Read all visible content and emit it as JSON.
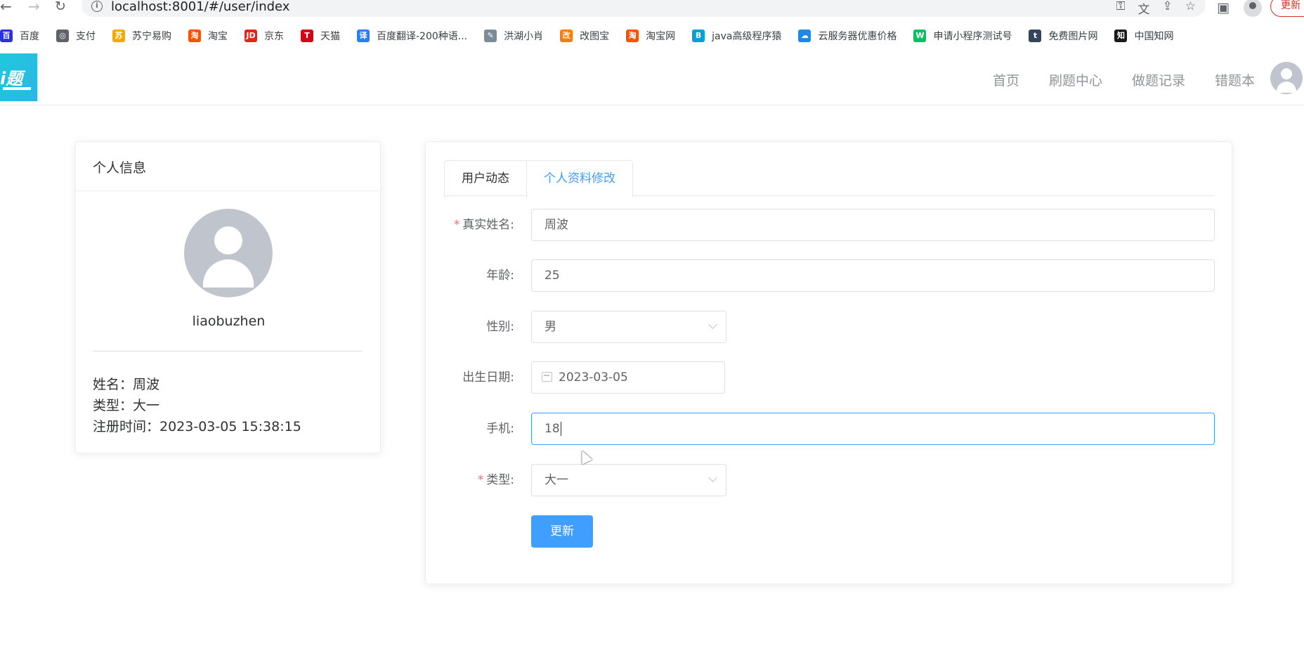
{
  "browser": {
    "url": "localhost:8001/#/user/index",
    "update_label": "更新",
    "bookmarks": [
      {
        "label": "百度",
        "icon": "baidu-icon",
        "color": "#2932e1",
        "glyph": "百"
      },
      {
        "label": "支付",
        "icon": "globe-icon",
        "color": "#5f6368",
        "glyph": "◎"
      },
      {
        "label": "苏宁易购",
        "icon": "suning-icon",
        "color": "#f7a800",
        "glyph": "苏"
      },
      {
        "label": "淘宝",
        "icon": "taobao-icon",
        "color": "#ff5000",
        "glyph": "淘"
      },
      {
        "label": "京东",
        "icon": "jd-icon",
        "color": "#e1251b",
        "glyph": "JD"
      },
      {
        "label": "天猫",
        "icon": "tmall-icon",
        "color": "#d70015",
        "glyph": "T"
      },
      {
        "label": "百度翻译-200种语...",
        "icon": "translate-icon",
        "color": "#2b7cfc",
        "glyph": "译"
      },
      {
        "label": "洪湖小肖",
        "icon": "bird-icon",
        "color": "#7a8c9a",
        "glyph": "✎"
      },
      {
        "label": "改图宝",
        "icon": "gaitubao-icon",
        "color": "#ff7a00",
        "glyph": "改"
      },
      {
        "label": "淘宝网",
        "icon": "taobao-icon",
        "color": "#ff5000",
        "glyph": "淘"
      },
      {
        "label": "java高级程序猿",
        "icon": "bilibili-icon",
        "color": "#00a1d6",
        "glyph": "B"
      },
      {
        "label": "云服务器优惠价格",
        "icon": "cloud-icon",
        "color": "#1e88e5",
        "glyph": "☁"
      },
      {
        "label": "申请小程序测试号",
        "icon": "wechat-icon",
        "color": "#07c160",
        "glyph": "W"
      },
      {
        "label": "免费图片网",
        "icon": "tumblr-icon",
        "color": "#35465c",
        "glyph": "t"
      },
      {
        "label": "中国知网",
        "icon": "cnki-icon",
        "color": "#1a1a1a",
        "glyph": "知"
      }
    ]
  },
  "header": {
    "logo_text": "i题",
    "nav": [
      "首页",
      "刷题中心",
      "做题记录",
      "错题本"
    ]
  },
  "profile": {
    "card_title": "个人信息",
    "username": "liaobuzhen",
    "name_line": "姓名：周波",
    "type_line": "类型：大一",
    "registered_line": "注册时间：2023-03-05 15:38:15"
  },
  "form": {
    "tabs": [
      "用户动态",
      "个人资料修改"
    ],
    "active_tab": "个人资料修改",
    "fields": {
      "real_name": {
        "label": "真实姓名:",
        "value": "周波",
        "required": true
      },
      "age": {
        "label": "年龄:",
        "value": "25"
      },
      "gender": {
        "label": "性别:",
        "value": "男"
      },
      "birthdate": {
        "label": "出生日期:",
        "value": "2023-03-05"
      },
      "phone": {
        "label": "手机:",
        "value": "18"
      },
      "user_type": {
        "label": "类型:",
        "value": "大一",
        "required": true
      }
    },
    "submit_label": "更新"
  },
  "colors": {
    "accent": "#409eff",
    "required": "#f56c6c",
    "logo": "#1fc8db"
  }
}
